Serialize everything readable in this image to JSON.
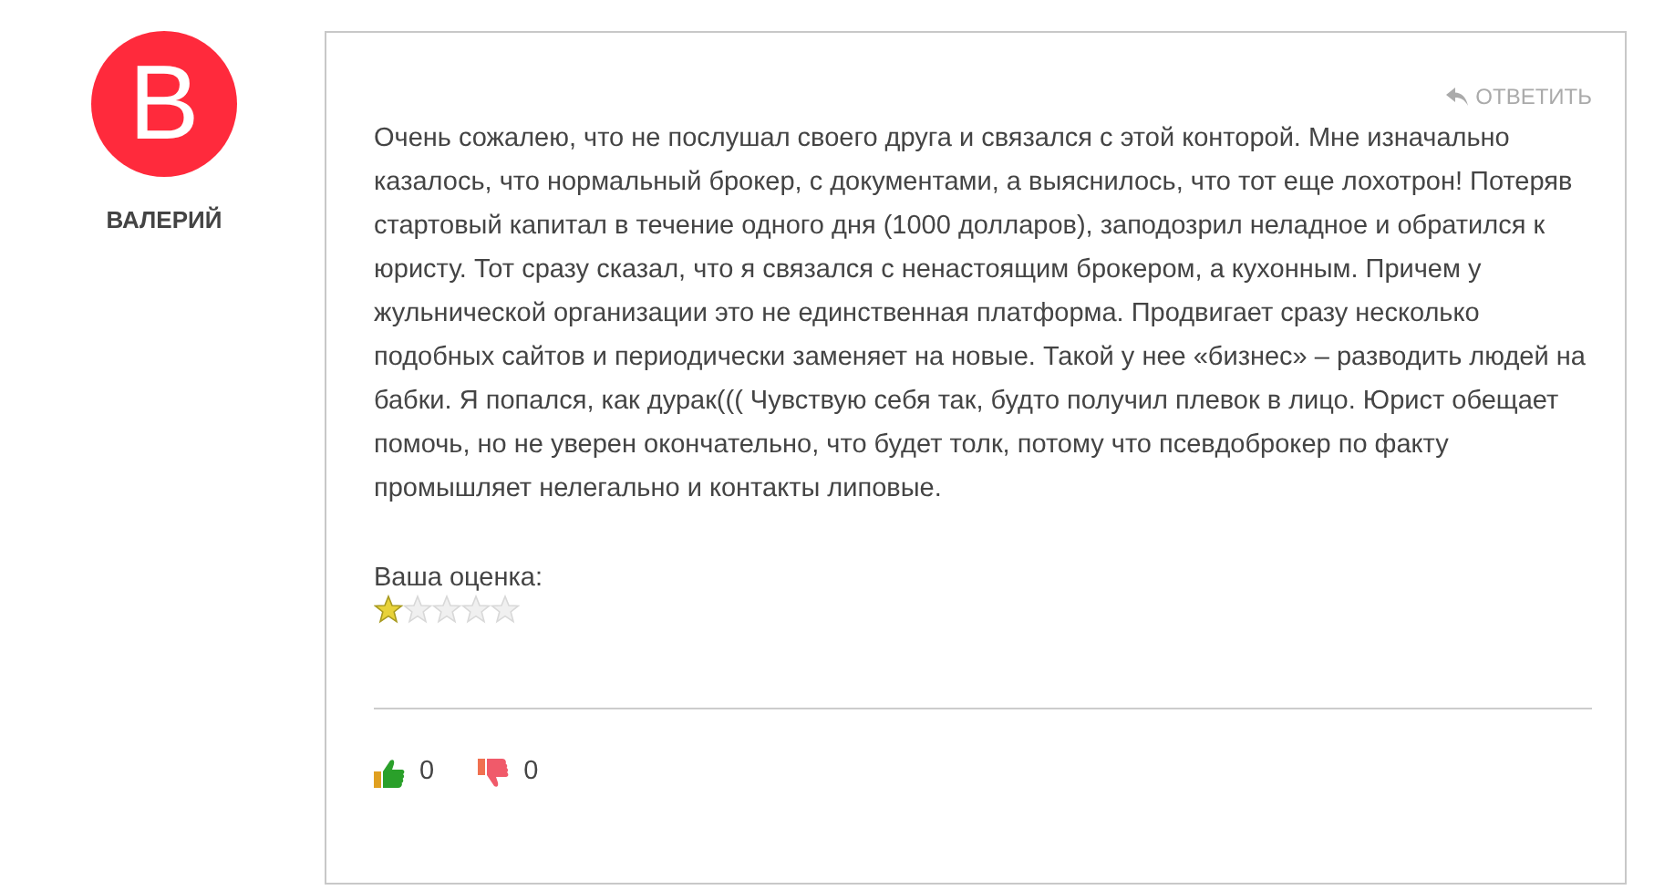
{
  "author": {
    "initial": "В",
    "name": "ВАЛЕРИЙ"
  },
  "reply": {
    "label": "ОТВЕТИТЬ"
  },
  "comment": {
    "text": "Очень сожалею, что не послушал своего друга и связался с этой конторой. Мне изначально казалось, что нормальный брокер, с документами, а выяснилось, что тот еще лохотрон! Потеряв стартовый капитал в течение одного дня (1000 долларов), заподозрил неладное и обратился к юристу. Тот сразу сказал, что я связался с ненастоящим брокером, а кухонным. Причем у жульнической организации это не единственная платформа. Продвигает сразу несколько подобных сайтов и периодически заменяет на новые. Такой у нее «бизнес» – разводить людей на бабки. Я попался, как дурак((( Чувствую себя так, будто получил плевок в лицо. Юрист обещает помочь, но не уверен окончательно, что будет толк, потому что псевдоброкер по факту промышляет нелегально и контакты липовые."
  },
  "rating": {
    "label": "Ваша оценка:",
    "stars": 1
  },
  "votes": [
    {
      "kind": "like",
      "count": "0"
    },
    {
      "kind": "dislike",
      "count": "0"
    }
  ]
}
